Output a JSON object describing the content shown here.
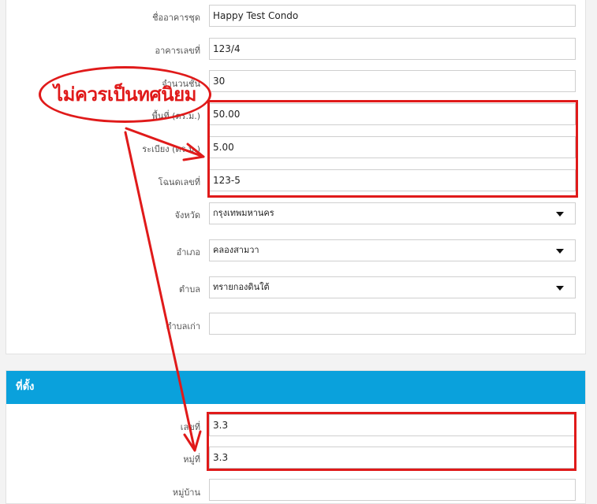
{
  "form": {
    "fields": [
      {
        "label": "ชื่ออาคารชุด",
        "value": "Happy Test Condo"
      },
      {
        "label": "อาคารเลขที่",
        "value": "123/4"
      },
      {
        "label": "จำนวนชั้น",
        "value": "30"
      },
      {
        "label": "พื้นที่ (ตร.ม.)",
        "value": "50.00"
      },
      {
        "label": "ระเบียง (ตร.ม.)",
        "value": "5.00"
      },
      {
        "label": "โฉนดเลขที่",
        "value": "123-5"
      },
      {
        "label": "จังหวัด",
        "value": "กรุงเทพมหานคร"
      },
      {
        "label": "อำเภอ",
        "value": "คลองสามวา"
      },
      {
        "label": "ตำบล",
        "value": "ทรายกองดินใต้"
      },
      {
        "label": "ตำบลเก่า",
        "value": ""
      }
    ]
  },
  "location": {
    "header": "ที่ตั้ง",
    "fields": [
      {
        "label": "เลขที่",
        "value": "3.3"
      },
      {
        "label": "หมู่ที่",
        "value": "3.3"
      },
      {
        "label": "หมู่บ้าน",
        "value": ""
      }
    ]
  },
  "annotation": {
    "text": "ไม่ควรเป็นทศนิยม",
    "color": "#e01a1a"
  },
  "colors": {
    "accent": "#0aa1dc",
    "highlight": "#e01a1a"
  }
}
